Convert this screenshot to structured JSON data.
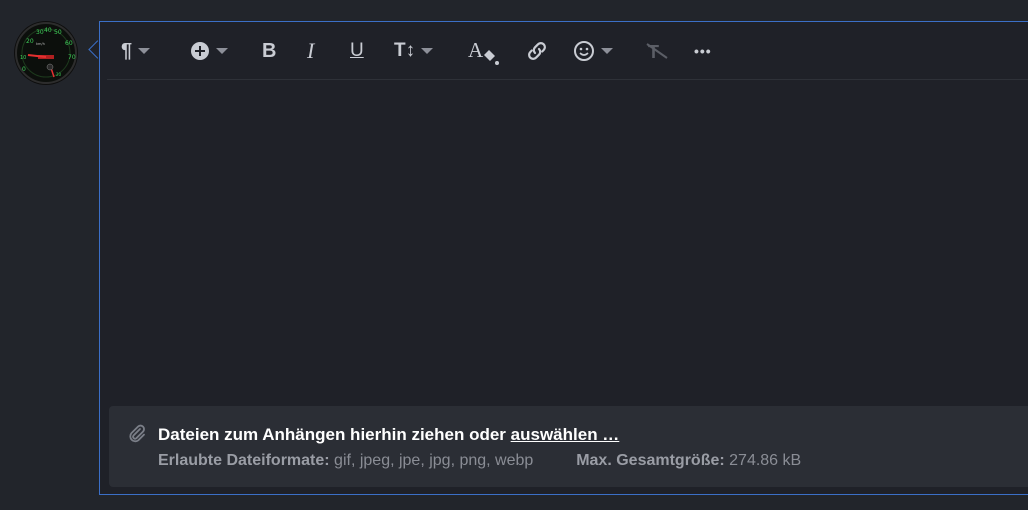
{
  "avatar": {
    "description": "speedometer-avatar",
    "gauge_labels": [
      "20",
      "30",
      "40",
      "50",
      "60",
      "70",
      "80",
      "10",
      "0"
    ]
  },
  "toolbar": {
    "items": [
      {
        "name": "paragraph-format-icon",
        "glyph": "¶",
        "has_caret": true
      },
      {
        "name": "insert-icon",
        "glyph": "⊕",
        "has_caret": true
      },
      {
        "name": "bold-icon",
        "glyph": "B",
        "has_caret": false
      },
      {
        "name": "italic-icon",
        "glyph": "I",
        "has_caret": false
      },
      {
        "name": "underline-icon",
        "glyph": "U",
        "has_caret": false
      },
      {
        "name": "text-size-icon",
        "glyph": "T↕",
        "has_caret": true
      },
      {
        "name": "text-color-icon",
        "glyph": "A",
        "has_caret": false
      },
      {
        "name": "link-icon",
        "glyph": "🔗",
        "has_caret": false
      },
      {
        "name": "emoji-icon",
        "glyph": "☺",
        "has_caret": true
      },
      {
        "name": "clear-format-icon",
        "glyph": "T̶",
        "has_caret": false,
        "disabled": true
      },
      {
        "name": "more-icon",
        "glyph": "•••",
        "has_caret": false
      }
    ]
  },
  "attachments": {
    "drop_text": "Dateien zum Anhängen hierhin ziehen oder",
    "select_link": "auswählen …",
    "formats_label": "Erlaubte Dateiformate:",
    "formats_value": "gif, jpeg, jpe, jpg, png, webp",
    "max_size_label": "Max. Gesamtgröße:",
    "max_size_value": "274.86 kB"
  },
  "colors": {
    "accent_border": "#3b6fc7",
    "background": "#22252b",
    "editor_bg": "#1f2128",
    "attach_bg": "#2b2e35"
  }
}
